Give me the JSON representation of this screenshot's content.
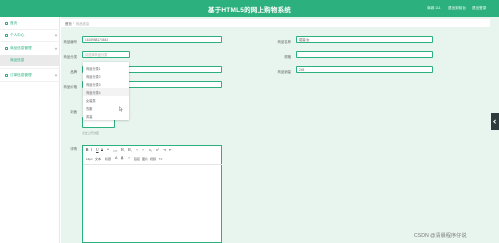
{
  "header": {
    "title": "基于HTML5的网上购物系统",
    "nav": [
      "商城 111",
      "退出到前台",
      "退出登录"
    ]
  },
  "sidebar": {
    "items": [
      {
        "label": "首页"
      },
      {
        "label": "个人中心"
      },
      {
        "label": "商品信息管理"
      },
      {
        "label": "订单信息管理"
      }
    ],
    "subitems": [
      {
        "label": "商品信息"
      }
    ]
  },
  "breadcrumb": {
    "home": "首页",
    "sep": "/",
    "current": "商品信息"
  },
  "form": {
    "labels": {
      "code": "商品编号",
      "name": "商品名称",
      "category": "商品分类",
      "spec": "规格",
      "brand": "品牌",
      "sales": "商品销量",
      "price": "商品价格",
      "image": "封面",
      "detail": "详情"
    },
    "values": {
      "code": "1618988174643",
      "name": "裙装/女",
      "category_placeholder": "请选择商品分类",
      "sales": "245"
    },
    "category_options": [
      "商品分类1",
      "商品分类2",
      "商品分类3",
      "商品分类4",
      "女装类",
      "衣服",
      "男装"
    ],
    "upload_tip": "点击上传封面"
  },
  "editor": {
    "toolbar_row1": [
      "B",
      "I",
      "U",
      "S",
      "❝",
      "</>",
      "H₁",
      "H₂",
      "≡",
      "≡",
      "x₂",
      "x²",
      "⇥",
      "⇤"
    ],
    "toolbar_row2": [
      "14px",
      "文本",
      "标题",
      "A",
      "A",
      "≡",
      "链接",
      "图片",
      "视频",
      "Tx"
    ]
  },
  "watermark": "CSDN @清晨程序仔说"
}
